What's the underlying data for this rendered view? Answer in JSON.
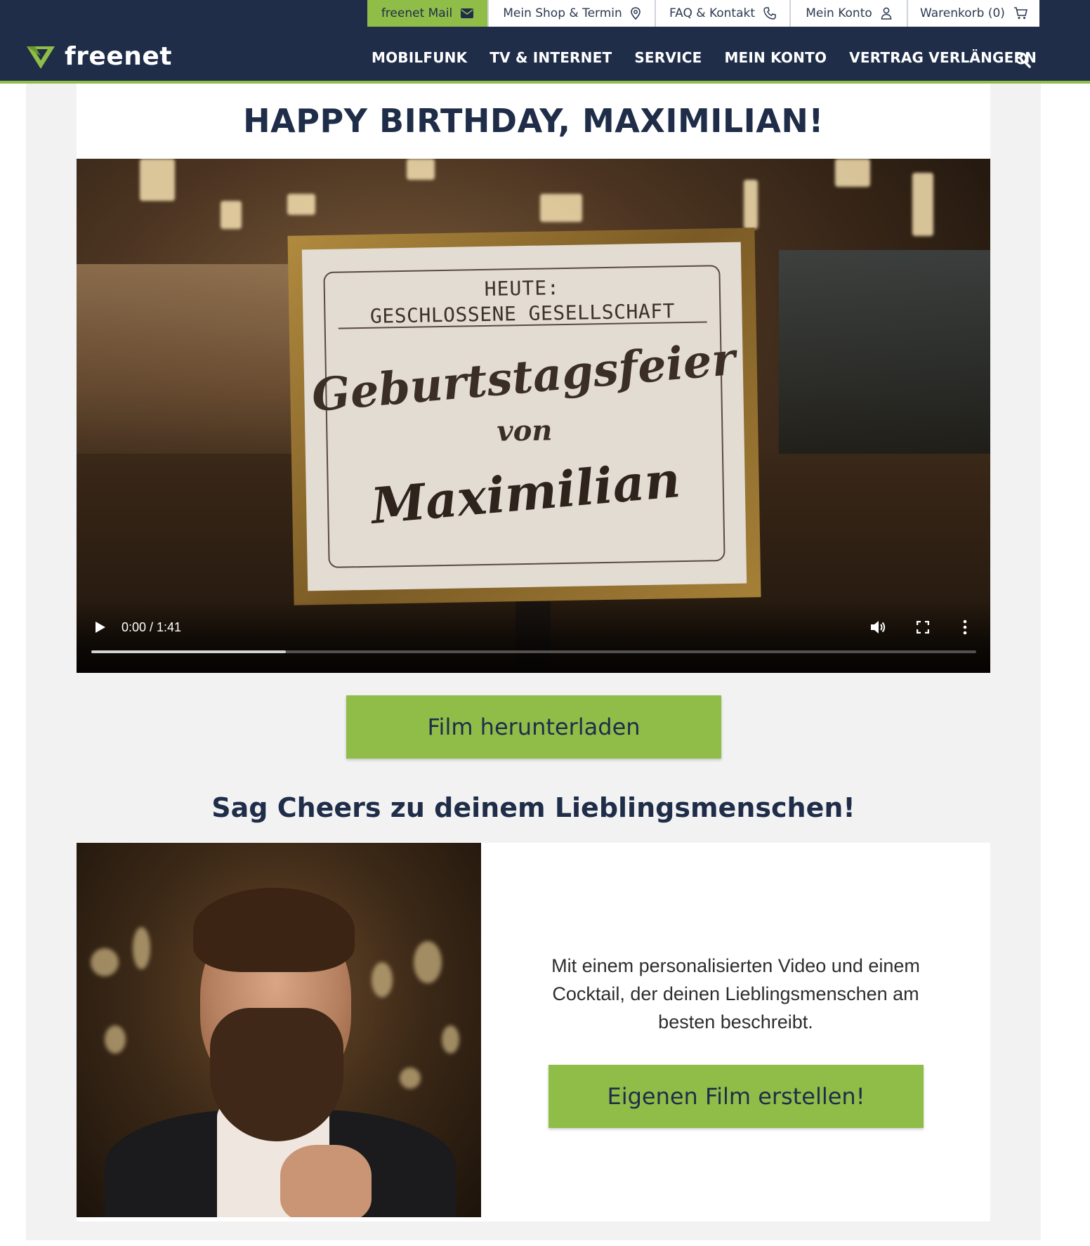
{
  "topbar": {
    "items": [
      {
        "label": "freenet Mail",
        "icon": "mail-icon"
      },
      {
        "label": "Mein Shop & Termin",
        "icon": "location-pin-icon"
      },
      {
        "label": "FAQ & Kontakt",
        "icon": "phone-icon"
      },
      {
        "label": "Mein Konto",
        "icon": "user-icon"
      },
      {
        "label": "Warenkorb (0)",
        "icon": "cart-icon"
      }
    ]
  },
  "brand": {
    "name": "freenet",
    "accent": "#8fbd48",
    "navy": "#1f2d49"
  },
  "nav": {
    "items": [
      "MOBILFUNK",
      "TV & INTERNET",
      "SERVICE",
      "MEIN KONTO",
      "VERTRAG VERLÄNGERN"
    ]
  },
  "hero": {
    "title": "HAPPY BIRTHDAY, MAXIMILIAN!"
  },
  "video": {
    "sign_line1": "HEUTE:",
    "sign_line2": "GESCHLOSSENE GESELLSCHAFT",
    "sign_script1": "Geburtstagsfeier",
    "sign_script2": "von",
    "sign_script3": "Maximilian",
    "time": "0:00 / 1:41",
    "progress": 0.22
  },
  "download": {
    "label": "Film herunterladen"
  },
  "section": {
    "title": "Sag Cheers zu deinem Lieblingsmenschen!"
  },
  "promo": {
    "text": "Mit einem personalisierten Video und einem Cocktail, der deinen Lieblingsmenschen am besten beschreibt.",
    "button": "Eigenen Film erstellen!"
  }
}
